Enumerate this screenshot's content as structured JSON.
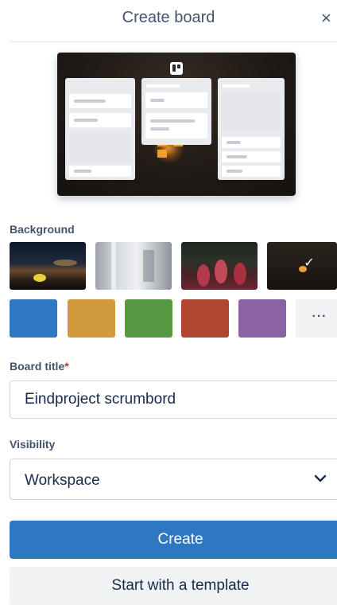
{
  "dialog": {
    "title": "Create board",
    "close_label": "×"
  },
  "background": {
    "label": "Background",
    "photos": [
      {
        "name": "mountain-night-photo",
        "selected": false
      },
      {
        "name": "white-building-photo",
        "selected": false
      },
      {
        "name": "tulips-photo",
        "selected": false
      },
      {
        "name": "dark-city-photo",
        "selected": true
      }
    ],
    "colors": [
      "#2d78c1",
      "#d09a3c",
      "#559a42",
      "#b04632",
      "#8b62a6"
    ],
    "more_label": "···"
  },
  "board_title": {
    "label": "Board title",
    "required_marker": "*",
    "value": "Eindproject scrumbord"
  },
  "visibility": {
    "label": "Visibility",
    "selected": "Workspace"
  },
  "actions": {
    "create_label": "Create",
    "template_label": "Start with a template"
  }
}
